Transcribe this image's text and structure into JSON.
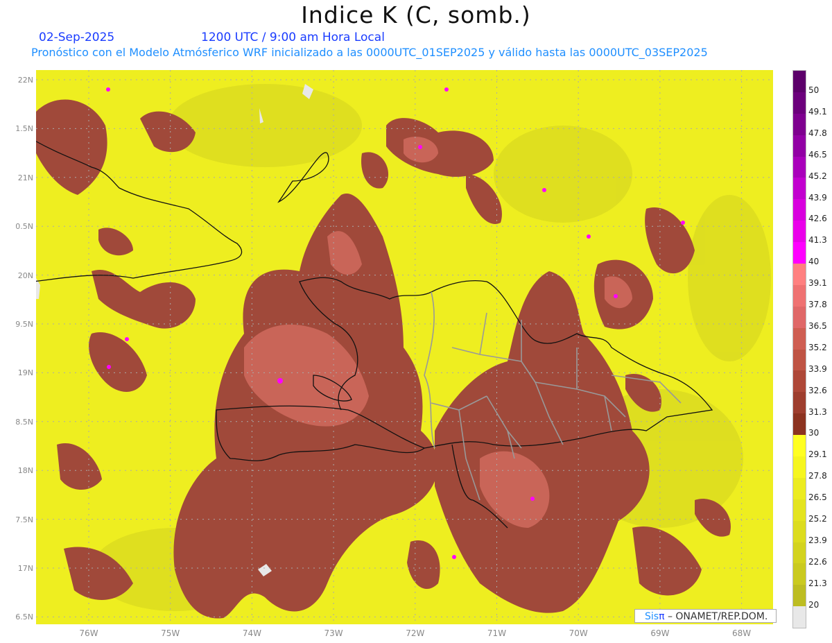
{
  "header": {
    "title": "Indice K (C, somb.)",
    "date": "02-Sep-2025",
    "time": "1200 UTC / 9:00 am Hora Local",
    "subtitle": "Pronóstico con el Modelo Atmósferico WRF inicializado a las 0000UTC_01SEP2025 y válido hasta las  0000UTC_03SEP2025"
  },
  "axes": {
    "lat_labels": [
      "22N",
      "1.5N",
      "21N",
      "0.5N",
      "20N",
      "9.5N",
      "19N",
      "8.5N",
      "18N",
      "7.5N",
      "17N",
      "6.5N"
    ],
    "lon_labels": [
      "76W",
      "75W",
      "74W",
      "73W",
      "72W",
      "71W",
      "70W",
      "69W",
      "68W"
    ]
  },
  "colorbar": {
    "labels": [
      "50",
      "49.1",
      "47.8",
      "46.5",
      "45.2",
      "43.9",
      "42.6",
      "41.3",
      "40",
      "39.1",
      "37.8",
      "36.5",
      "35.2",
      "33.9",
      "32.6",
      "31.3",
      "30",
      "29.1",
      "27.8",
      "26.5",
      "25.2",
      "23.9",
      "22.6",
      "21.3",
      "20"
    ],
    "colors": [
      "#5c006a",
      "#6c007c",
      "#7e008f",
      "#9200a5",
      "#a900bb",
      "#c200cf",
      "#d800de",
      "#ea00ea",
      "#ff00ff",
      "#ff8080",
      "#ef7272",
      "#e06868",
      "#cf5e52",
      "#bf5444",
      "#ae4838",
      "#9e3e2e",
      "#8c3320",
      "#ffff22",
      "#f6f61f",
      "#ecec20",
      "#e4e420",
      "#dcdc1f",
      "#d3d31f",
      "#caca20",
      "#bdbd22",
      "#e8e8e8"
    ]
  },
  "credit": {
    "sis": "Sis",
    "pi": "π",
    "rest": " –  ONAMET/REP.DOM."
  }
}
